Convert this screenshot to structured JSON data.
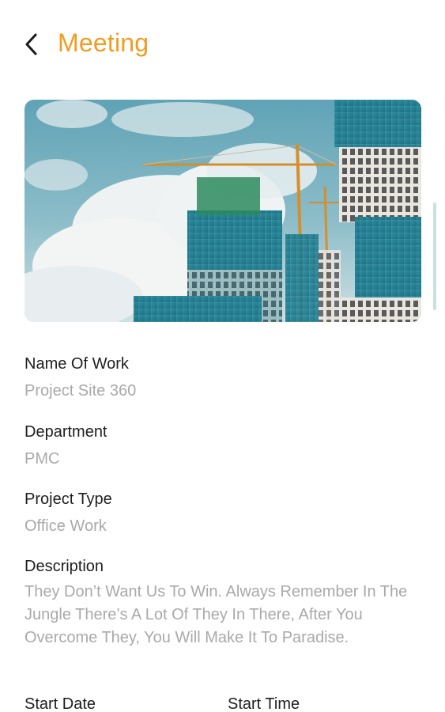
{
  "header": {
    "title": "Meeting",
    "back_icon": "chevron-left-icon",
    "title_color": "#f39c1f"
  },
  "hero": {
    "image": "construction-site-photo"
  },
  "details": {
    "name_of_work": {
      "label": "Name Of Work",
      "value": "Project Site 360"
    },
    "department": {
      "label": "Department",
      "value": "PMC"
    },
    "project_type": {
      "label": "Project Type",
      "value": "Office Work"
    },
    "description": {
      "label": "Description",
      "value": "They Don’t Want Us To Win. Always Remember In The Jungle There’s A Lot Of They In There, After You Overcome They, You Will Make It To Paradise."
    },
    "start_date": {
      "label": "Start Date"
    },
    "start_time": {
      "label": "Start Time"
    }
  }
}
